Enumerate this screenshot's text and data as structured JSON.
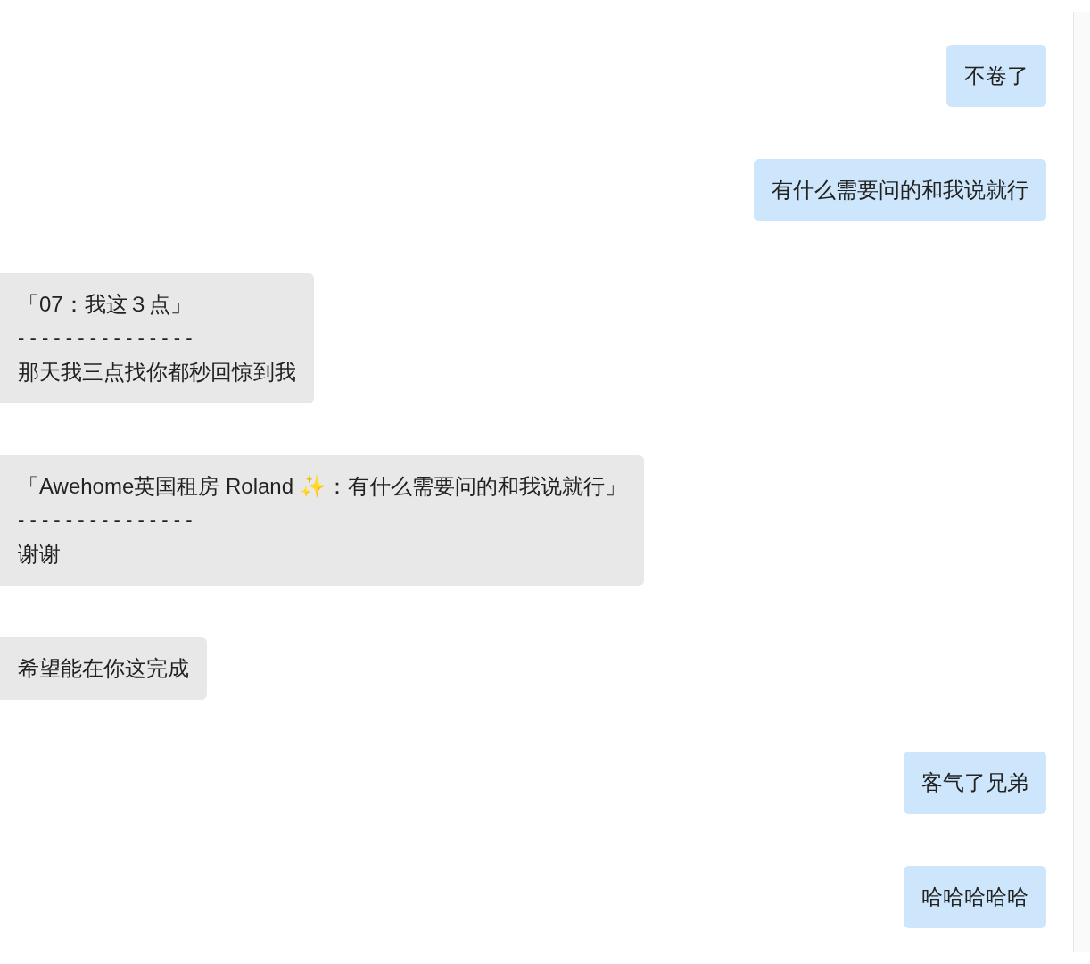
{
  "messages": [
    {
      "outgoing": true,
      "kind": "text",
      "text": "不卷了"
    },
    {
      "outgoing": true,
      "kind": "text",
      "text": "有什么需要问的和我说就行"
    },
    {
      "outgoing": false,
      "kind": "quote",
      "quote": "「07：我这３点」",
      "separator": "- - - - - - - - - - - - - - -",
      "text": "那天我三点找你都秒回惊到我"
    },
    {
      "outgoing": false,
      "kind": "quote",
      "quote": "「Awehome英国租房 Roland ✨：有什么需要问的和我说就行」",
      "separator": "- - - - - - - - - - - - - - -",
      "text": "谢谢"
    },
    {
      "outgoing": false,
      "kind": "text",
      "text": "希望能在你这完成"
    },
    {
      "outgoing": true,
      "kind": "text",
      "text": "客气了兄弟"
    },
    {
      "outgoing": true,
      "kind": "text",
      "text": "哈哈哈哈哈"
    }
  ]
}
